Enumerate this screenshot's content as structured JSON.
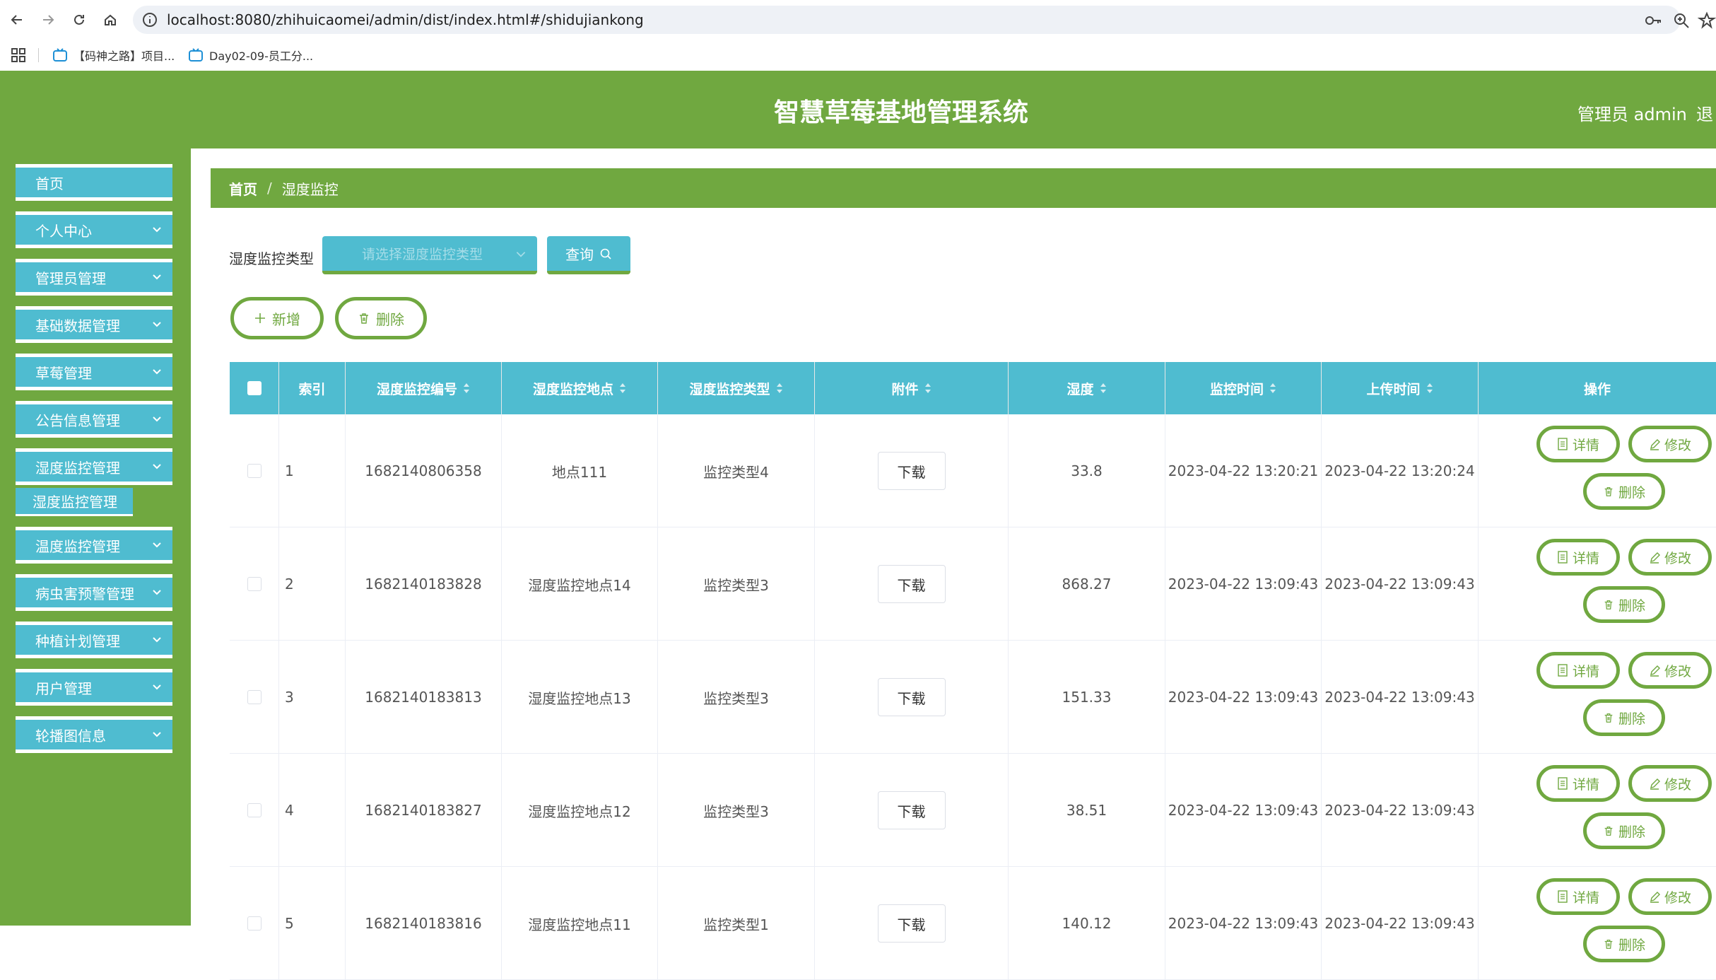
{
  "browser": {
    "url": "localhost:8080/zhihuicaomei/admin/dist/index.html#/shidujiankong",
    "bookmarks": [
      "【码神之路】项目...",
      "Day02-09-员工分..."
    ]
  },
  "header": {
    "title": "智慧草莓基地管理系统",
    "user": "管理员 admin",
    "logout": "退"
  },
  "sidebar": {
    "items": [
      {
        "label": "首页"
      },
      {
        "label": "个人中心"
      },
      {
        "label": "管理员管理"
      },
      {
        "label": "基础数据管理"
      },
      {
        "label": "草莓管理"
      },
      {
        "label": "公告信息管理"
      },
      {
        "label": "湿度监控管理"
      },
      {
        "label": "温度监控管理"
      },
      {
        "label": "病虫害预警管理"
      },
      {
        "label": "种植计划管理"
      },
      {
        "label": "用户管理"
      },
      {
        "label": "轮播图信息"
      }
    ],
    "active_sub": "湿度监控管理"
  },
  "breadcrumb": {
    "home": "首页",
    "sep": "/",
    "current": "湿度监控"
  },
  "filter": {
    "label": "湿度监控类型",
    "placeholder": "请选择湿度监控类型",
    "query": "查询"
  },
  "actions": {
    "add": "新增",
    "delete": "删除"
  },
  "table": {
    "headers": [
      "索引",
      "湿度监控编号",
      "湿度监控地点",
      "湿度监控类型",
      "附件",
      "湿度",
      "监控时间",
      "上传时间",
      "操作"
    ],
    "download_label": "下载",
    "op_labels": {
      "detail": "详情",
      "edit": "修改",
      "delete": "删除"
    },
    "rows": [
      {
        "index": "1",
        "code": "1682140806358",
        "place": "地点111",
        "type": "监控类型4",
        "humidity": "33.8",
        "monitor_time": "2023-04-22 13:20:21",
        "upload_time": "2023-04-22 13:20:24"
      },
      {
        "index": "2",
        "code": "1682140183828",
        "place": "湿度监控地点14",
        "type": "监控类型3",
        "humidity": "868.27",
        "monitor_time": "2023-04-22 13:09:43",
        "upload_time": "2023-04-22 13:09:43"
      },
      {
        "index": "3",
        "code": "1682140183813",
        "place": "湿度监控地点13",
        "type": "监控类型3",
        "humidity": "151.33",
        "monitor_time": "2023-04-22 13:09:43",
        "upload_time": "2023-04-22 13:09:43"
      },
      {
        "index": "4",
        "code": "1682140183827",
        "place": "湿度监控地点12",
        "type": "监控类型3",
        "humidity": "38.51",
        "monitor_time": "2023-04-22 13:09:43",
        "upload_time": "2023-04-22 13:09:43"
      },
      {
        "index": "5",
        "code": "1682140183816",
        "place": "湿度监控地点11",
        "type": "监控类型1",
        "humidity": "140.12",
        "monitor_time": "2023-04-22 13:09:43",
        "upload_time": "2023-04-22 13:09:43"
      }
    ]
  },
  "colors": {
    "green": "#70a840",
    "teal": "#4fbcd0"
  }
}
